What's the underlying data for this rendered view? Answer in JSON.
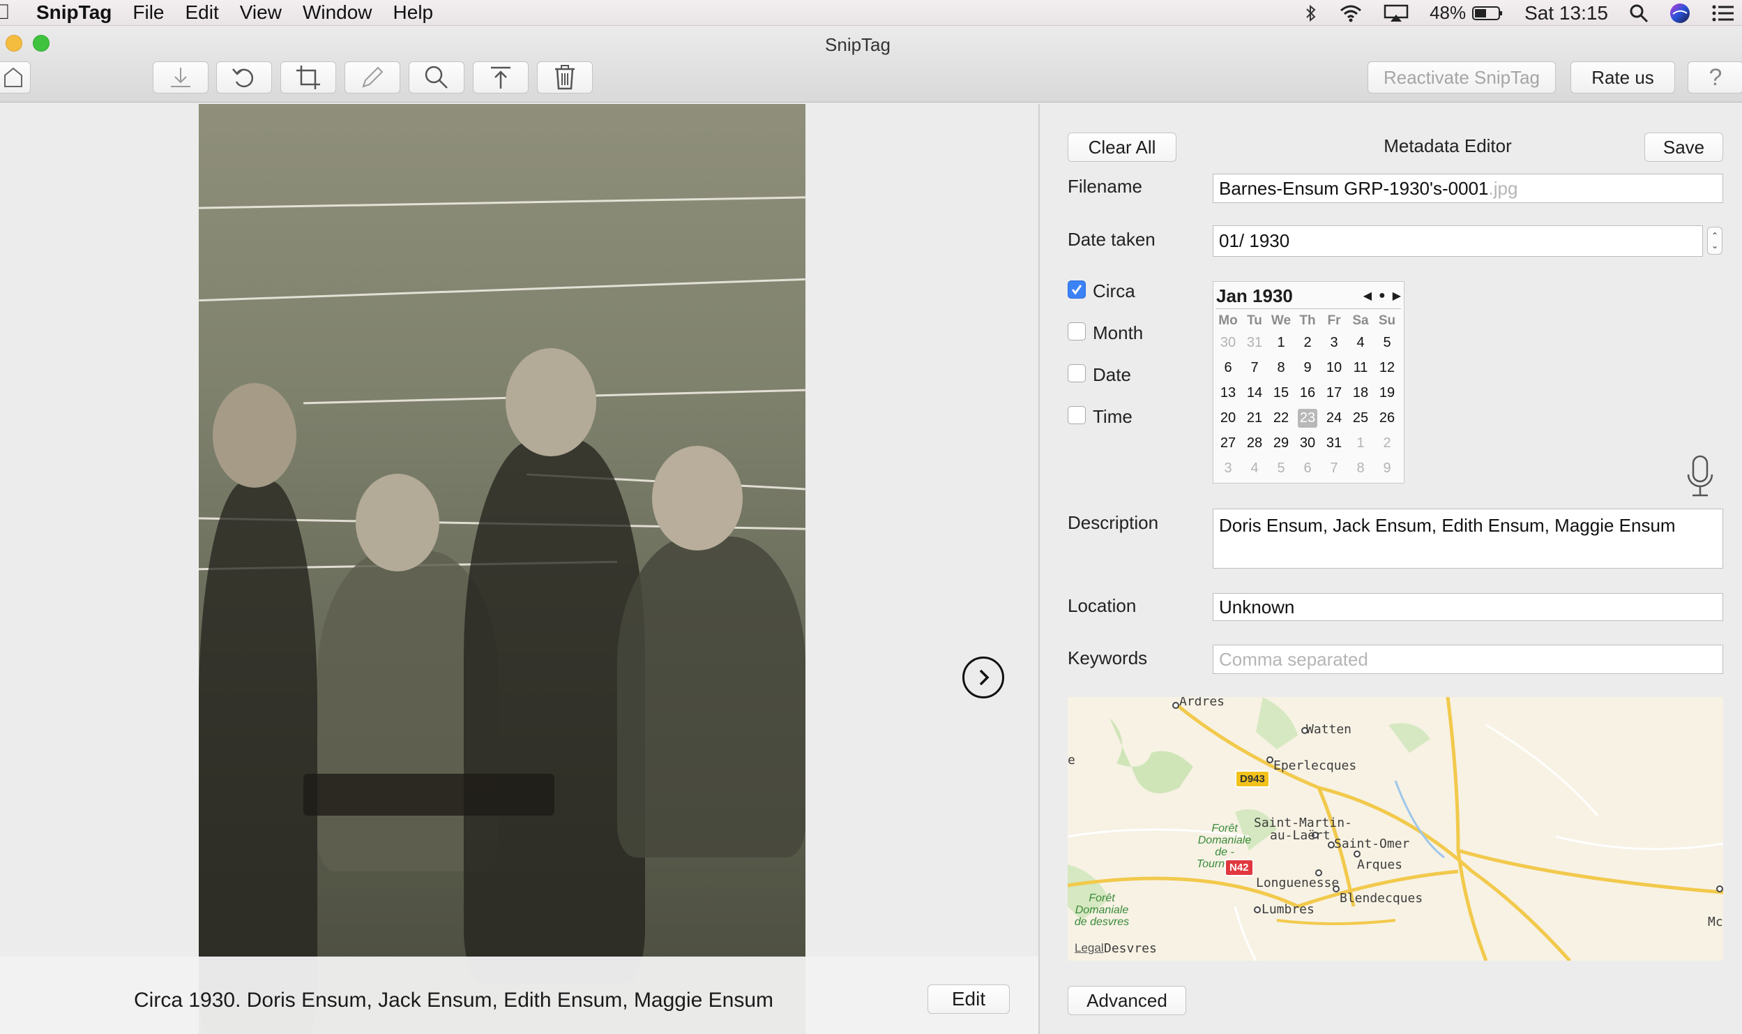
{
  "menubar": {
    "app_name": "SnipTag",
    "items": [
      "File",
      "Edit",
      "View",
      "Window",
      "Help"
    ],
    "battery": "48%",
    "clock": "Sat 13:15"
  },
  "window": {
    "title": "SnipTag",
    "reactivate_label": "Reactivate SnipTag",
    "rate_label": "Rate us",
    "help_label": "?"
  },
  "photo": {
    "caption": "Circa 1930. Doris Ensum, Jack Ensum, Edith Ensum, Maggie Ensum",
    "edit_label": "Edit"
  },
  "editor": {
    "title": "Metadata Editor",
    "clear_label": "Clear All",
    "save_label": "Save",
    "filename_label": "Filename",
    "filename_value": "Barnes-Ensum GRP-1930's-0001",
    "filename_ext": ".jpg",
    "date_label": "Date taken",
    "date_value": "01/ 1930",
    "checks": [
      {
        "label": "Circa",
        "checked": true
      },
      {
        "label": "Month",
        "checked": false
      },
      {
        "label": "Date",
        "checked": false
      },
      {
        "label": "Time",
        "checked": false
      }
    ],
    "description_label": "Description",
    "description_value": "Doris Ensum, Jack Ensum, Edith Ensum, Maggie Ensum",
    "location_label": "Location",
    "location_value": "Unknown",
    "keywords_label": "Keywords",
    "keywords_placeholder": "Comma separated",
    "advanced_label": "Advanced"
  },
  "calendar": {
    "month_label": "Jan 1930",
    "weekdays": [
      "Mo",
      "Tu",
      "We",
      "Th",
      "Fr",
      "Sa",
      "Su"
    ],
    "weeks": [
      [
        "30",
        "31",
        "1",
        "2",
        "3",
        "4",
        "5"
      ],
      [
        "6",
        "7",
        "8",
        "9",
        "10",
        "11",
        "12"
      ],
      [
        "13",
        "14",
        "15",
        "16",
        "17",
        "18",
        "19"
      ],
      [
        "20",
        "21",
        "22",
        "23",
        "24",
        "25",
        "26"
      ],
      [
        "27",
        "28",
        "29",
        "30",
        "31",
        "1",
        "2"
      ],
      [
        "3",
        "4",
        "5",
        "6",
        "7",
        "8",
        "9"
      ]
    ],
    "selected": "23"
  },
  "map": {
    "places": [
      "Ardres",
      "Watten",
      "Eperlecques",
      "Saint-Martin-",
      "au-Laërt",
      "Saint-Omer",
      "Arques",
      "Longuenesse",
      "Blendecques",
      "Lumbres",
      "Desvres",
      "e",
      "Mc"
    ],
    "forests": [
      "Forêt",
      "Domaniale",
      "de -",
      "Tournehem",
      "Forêt",
      "Domaniale",
      "de desvres"
    ],
    "roads": [
      "D943",
      "N42"
    ],
    "legal": "Legal"
  }
}
